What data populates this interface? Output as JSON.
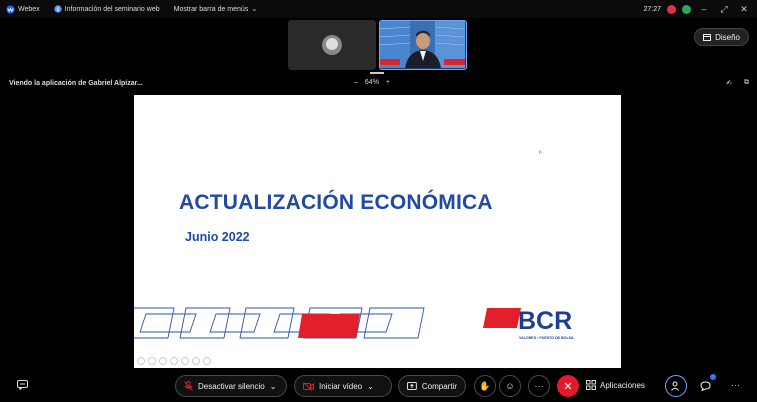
{
  "titlebar": {
    "app_name": "Webex",
    "info_label": "Información del seminario web",
    "menu_label": "Mostrar barra de menús",
    "time": "27:27",
    "minimize": "–",
    "restore": "⤢",
    "close": "✕"
  },
  "layout_button": {
    "label": "Diseño"
  },
  "share": {
    "viewing_label": "Viendo la aplicación de Gabriel Alpízar...",
    "zoom_minus": "–",
    "zoom_level": "64%",
    "zoom_plus": "+"
  },
  "slide": {
    "title": "ACTUALIZACIÓN ECONÓMICA",
    "subtitle": "Junio 2022",
    "logo_text": "BCR",
    "logo_subtext": "VALORES • PUESTO DE BOLSA"
  },
  "toolbar": {
    "mute_label": "Desactivar silencio",
    "video_label": "Iniciar vídeo",
    "share_label": "Compartir",
    "apps_label": "Aplicaciones",
    "more": "···"
  },
  "colors": {
    "accent_blue": "#2f7cf6",
    "leave_red": "#e21b2c",
    "slide_title_blue": "#1f4aa8",
    "bcr_red": "#e2202b",
    "bcr_blue": "#1e3f8f"
  }
}
